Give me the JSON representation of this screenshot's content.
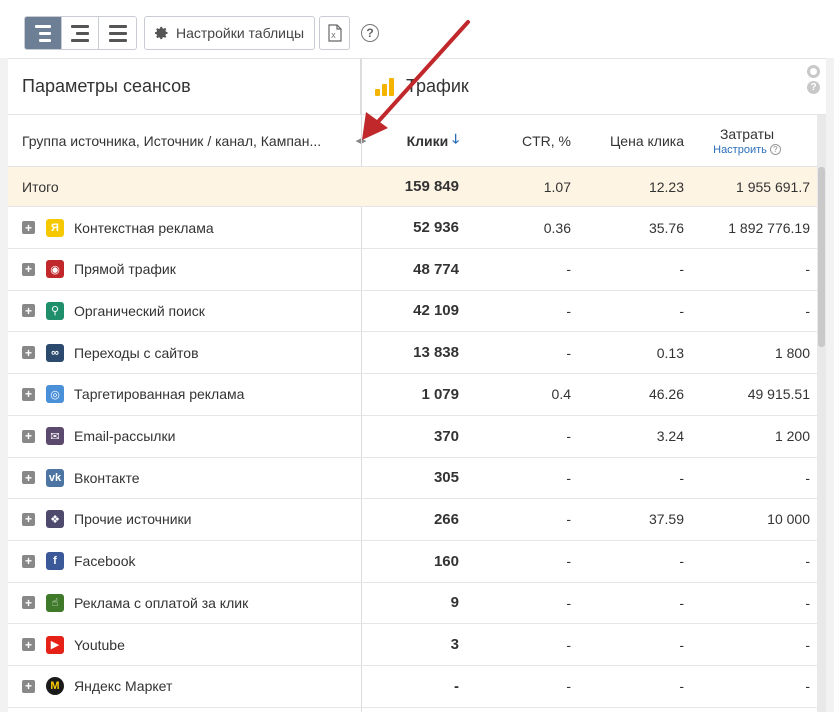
{
  "toolbar": {
    "settings_label": "Настройки таблицы",
    "help_label": "?",
    "excel_label": "X"
  },
  "groups": {
    "left_title": "Параметры сеансов",
    "right_title": "Трафик"
  },
  "columns": {
    "name": "Группа источника, Источник / канал, Кампан...",
    "clicks": "Клики",
    "ctr": "CTR, %",
    "cpc": "Цена клика",
    "cost": "Затраты",
    "cost_link": "Настроить"
  },
  "total": {
    "label": "Итого",
    "clicks": "159 849",
    "ctr": "1.07",
    "cpc": "12.23",
    "cost": "1 955 691.7"
  },
  "rows": [
    {
      "name": "Контекстная реклама",
      "icon": "yandex-direct-icon",
      "color": "#f6c800",
      "glyph": "Я",
      "clicks": "52 936",
      "ctr": "0.36",
      "cpc": "35.76",
      "cost": "1 892 776.19"
    },
    {
      "name": "Прямой трафик",
      "icon": "direct-traffic-icon",
      "color": "#c0282b",
      "glyph": "◉",
      "clicks": "48 774",
      "ctr": "-",
      "cpc": "-",
      "cost": "-"
    },
    {
      "name": "Органический поиск",
      "icon": "search-icon",
      "color": "#1e8f6a",
      "glyph": "⚲",
      "clicks": "42 109",
      "ctr": "-",
      "cpc": "-",
      "cost": "-"
    },
    {
      "name": "Переходы с сайтов",
      "icon": "link-icon",
      "color": "#2c4a6e",
      "glyph": "∞",
      "clicks": "13 838",
      "ctr": "-",
      "cpc": "0.13",
      "cost": "1 800"
    },
    {
      "name": "Таргетированная реклама",
      "icon": "target-icon",
      "color": "#4a90d9",
      "glyph": "◎",
      "clicks": "1 079",
      "ctr": "0.4",
      "cpc": "46.26",
      "cost": "49 915.51"
    },
    {
      "name": "Email-рассылки",
      "icon": "email-icon",
      "color": "#5b4a6e",
      "glyph": "✉",
      "clicks": "370",
      "ctr": "-",
      "cpc": "3.24",
      "cost": "1 200"
    },
    {
      "name": "Вконтакте",
      "icon": "vk-icon",
      "color": "#4c75a3",
      "glyph": "vk",
      "clicks": "305",
      "ctr": "-",
      "cpc": "-",
      "cost": "-"
    },
    {
      "name": "Прочие источники",
      "icon": "other-sources-icon",
      "color": "#4e4a6e",
      "glyph": "❖",
      "clicks": "266",
      "ctr": "-",
      "cpc": "37.59",
      "cost": "10 000"
    },
    {
      "name": "Facebook",
      "icon": "facebook-icon",
      "color": "#3b5998",
      "glyph": "f",
      "clicks": "160",
      "ctr": "-",
      "cpc": "-",
      "cost": "-"
    },
    {
      "name": "Реклама с оплатой за клик",
      "icon": "cpc-ads-icon",
      "color": "#3f7a2a",
      "glyph": "☝",
      "clicks": "9",
      "ctr": "-",
      "cpc": "-",
      "cost": "-"
    },
    {
      "name": "Youtube",
      "icon": "youtube-icon",
      "color": "#e62117",
      "glyph": "▶",
      "clicks": "3",
      "ctr": "-",
      "cpc": "-",
      "cost": "-"
    },
    {
      "name": "Яндекс Маркет",
      "icon": "yandex-market-icon",
      "color": "#1a1a1a",
      "glyph": "M",
      "clicks": "-",
      "ctr": "-",
      "cpc": "-",
      "cost": "-"
    }
  ]
}
